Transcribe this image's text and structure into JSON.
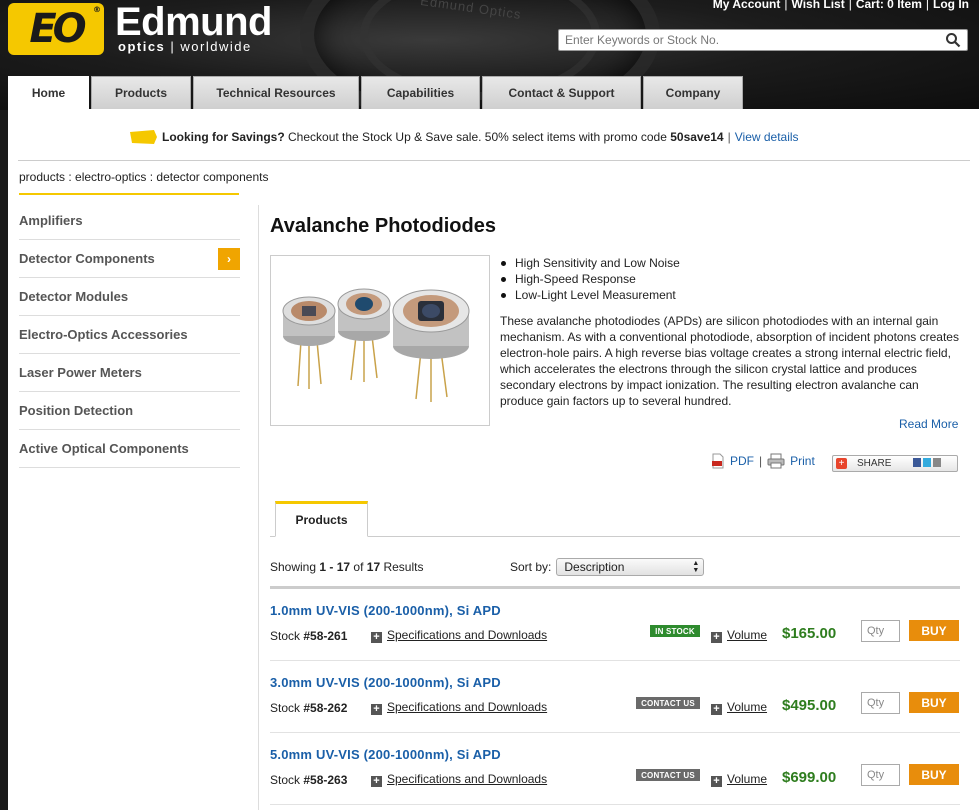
{
  "header": {
    "logo_mark": "EO",
    "logo_word": "Edmund",
    "logo_sub_bold": "optics",
    "logo_sub_rest": "| worldwide",
    "util_links": [
      "My Account",
      "Wish List",
      "Cart: 0 Item",
      "Log In"
    ],
    "search_placeholder": "Enter Keywords or Stock No.",
    "lens_text": "Edmund Optics"
  },
  "nav": {
    "tabs": [
      {
        "label": "Home",
        "active": true
      },
      {
        "label": "Products",
        "active": false
      },
      {
        "label": "Technical Resources",
        "active": false
      },
      {
        "label": "Capabilities",
        "active": false
      },
      {
        "label": "Contact & Support",
        "active": false
      },
      {
        "label": "Company",
        "active": false
      }
    ]
  },
  "promo": {
    "lead": "Looking for Savings?",
    "text": "Checkout the Stock Up & Save sale. 50% select items with promo code",
    "code": "50save14",
    "link": "View details"
  },
  "breadcrumb": "products : electro-optics : detector components",
  "sidebar": {
    "items": [
      {
        "label": "Amplifiers"
      },
      {
        "label": "Detector Components",
        "current": true
      },
      {
        "label": "Detector Modules"
      },
      {
        "label": "Electro-Optics Accessories"
      },
      {
        "label": "Laser Power Meters"
      },
      {
        "label": "Position Detection"
      },
      {
        "label": "Active Optical Components"
      }
    ]
  },
  "product": {
    "title": "Avalanche Photodiodes",
    "bullets": [
      "High Sensitivity and Low Noise",
      "High-Speed Response",
      "Low-Light Level Measurement"
    ],
    "description": "These avalanche photodiodes (APDs) are silicon photodiodes with an internal gain mechanism. As with a conventional photodiode, absorption of incident photons creates electron-hole pairs. A high reverse bias voltage creates a strong internal electric field, which accelerates the electrons through the silicon crystal lattice and produces secondary electrons by impact ionization. The resulting electron avalanche can produce gain factors up to several hundred.",
    "read_more": "Read More"
  },
  "tools": {
    "pdf": "PDF",
    "print": "Print",
    "share": "SHARE"
  },
  "tabs": {
    "products": "Products"
  },
  "listing": {
    "showing_prefix": "Showing",
    "range": "1 - 17",
    "of": "of",
    "total": "17",
    "results": "Results",
    "sort_label": "Sort by:",
    "sort_value": "Description"
  },
  "rows": [
    {
      "name": "1.0mm UV-VIS (200-1000nm), Si APD",
      "stock_label": "Stock",
      "stock_no": "#58-261",
      "specs": "Specifications and Downloads",
      "badge": "IN STOCK",
      "badge_type": "instock",
      "volume": "Volume",
      "price": "$165.00",
      "qty_placeholder": "Qty",
      "buy": "BUY"
    },
    {
      "name": "3.0mm UV-VIS (200-1000nm), Si APD",
      "stock_label": "Stock",
      "stock_no": "#58-262",
      "specs": "Specifications and Downloads",
      "badge": "CONTACT US",
      "badge_type": "contact",
      "volume": "Volume",
      "price": "$495.00",
      "qty_placeholder": "Qty",
      "buy": "BUY"
    },
    {
      "name": "5.0mm UV-VIS (200-1000nm), Si APD",
      "stock_label": "Stock",
      "stock_no": "#58-263",
      "specs": "Specifications and Downloads",
      "badge": "CONTACT US",
      "badge_type": "contact",
      "volume": "Volume",
      "price": "$699.00",
      "qty_placeholder": "Qty",
      "buy": "BUY"
    }
  ],
  "colors": {
    "brand_yellow": "#f5c800",
    "link_blue": "#1a5fa8",
    "price_green": "#2e7d1e",
    "buy_orange": "#e88d0c",
    "in_stock_green": "#2e8b2e"
  }
}
